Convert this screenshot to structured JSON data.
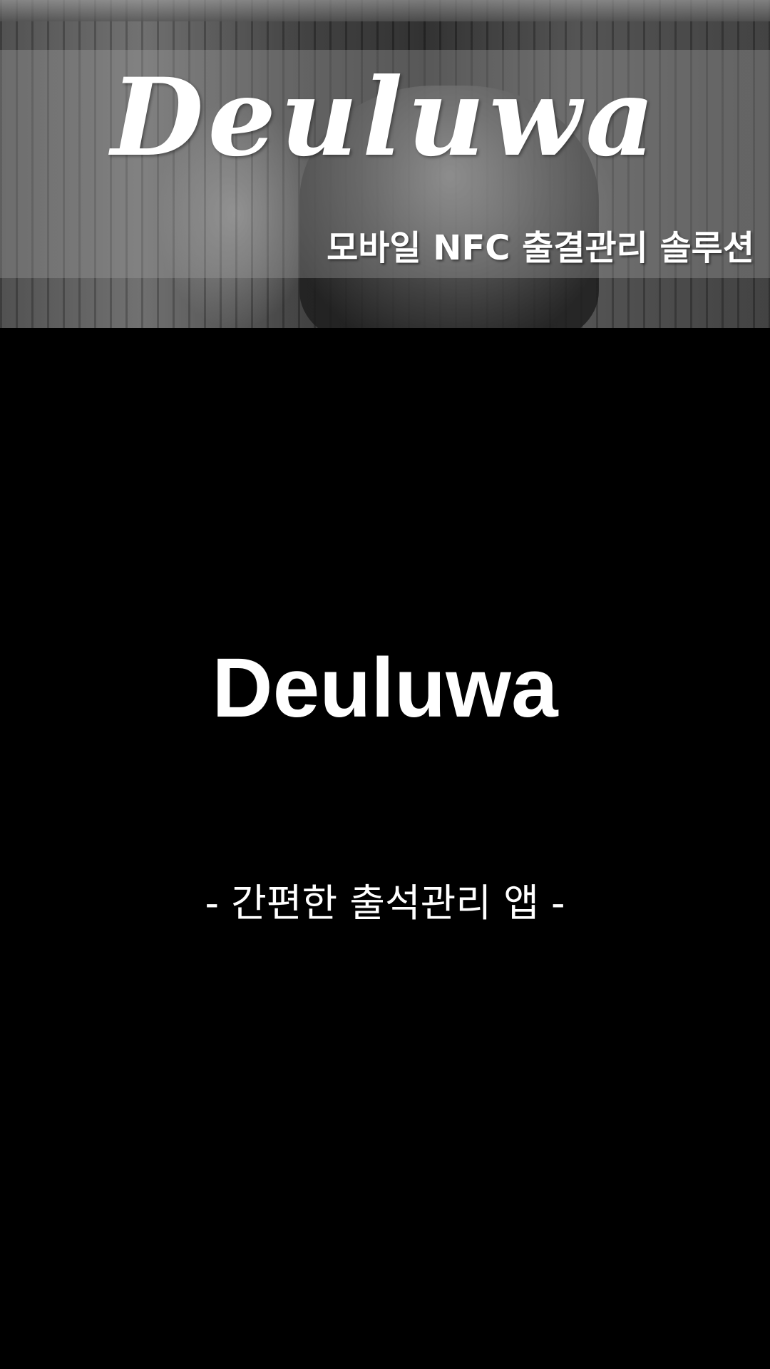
{
  "banner": {
    "title": "Deuluwa",
    "subtitle": "모바일 NFC 출결관리 솔루션"
  },
  "main": {
    "app_name": "Deuluwa",
    "tagline": "- 간편한 출석관리 앱 -"
  },
  "colors": {
    "background": "#000000",
    "text": "#ffffff"
  }
}
